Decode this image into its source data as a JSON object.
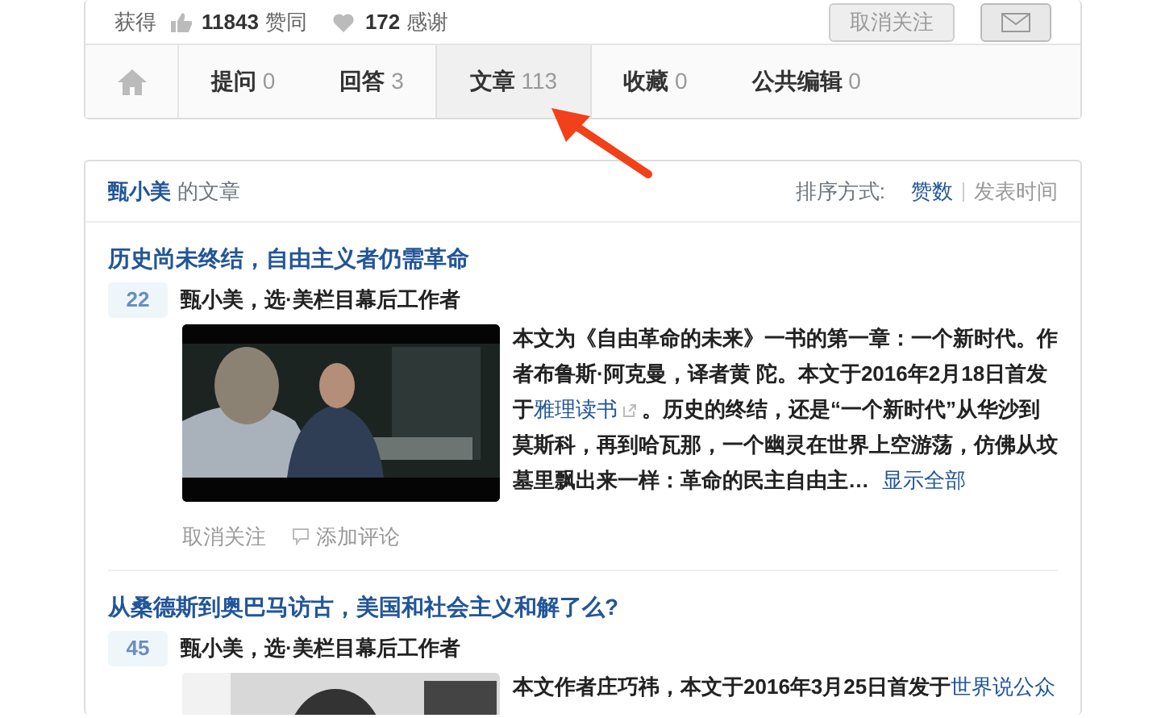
{
  "profile": {
    "prefix": "获得",
    "stats": [
      {
        "kind": "like",
        "count": "11843",
        "label": "赞同"
      },
      {
        "kind": "thanks",
        "count": "172",
        "label": "感谢"
      }
    ],
    "unfollow_button": "取消关注"
  },
  "tabs": [
    {
      "label": "提问",
      "count": "0",
      "selected": false
    },
    {
      "label": "回答",
      "count": "3",
      "selected": false
    },
    {
      "label": "文章",
      "count": "113",
      "selected": true
    },
    {
      "label": "收藏",
      "count": "0",
      "selected": false
    },
    {
      "label": "公共编辑",
      "count": "0",
      "selected": false
    }
  ],
  "articles_header": {
    "owner": "甄小美",
    "suffix": "的文章",
    "sort_label": "排序方式:",
    "sort_options": [
      {
        "label": "赞数",
        "selected": true
      },
      {
        "label": "发表时间",
        "selected": false
      }
    ]
  },
  "articles": [
    {
      "title": "历史尚未终结，自由主义者仍需革命",
      "votes": "22",
      "author": "甄小美，选·美栏目幕后工作者",
      "picture": {
        "kind": "picture"
      },
      "excerpt": [
        {
          "kind": "text",
          "text": "本文为《自由革命的未来》一书的第一章：一个新时代。作者布鲁斯·阿克曼，译者黄 陀。本文于2016年2月18日首发于"
        },
        {
          "kind": "link",
          "text": "雅理读书",
          "external_icon": true
        },
        {
          "kind": "text",
          "text": "。历史的终结，还是“一个新时代”从华沙到莫斯科，再到哈瓦那，一个幽灵在世界上空游荡，仿佛从坟墓里飘出来一样：革命的民主自由主…"
        }
      ],
      "more": "显示全部",
      "actions": [
        {
          "kind": "unfollow",
          "label": "取消关注"
        },
        {
          "kind": "comment",
          "label": "添加评论"
        }
      ]
    },
    {
      "title": "从桑德斯到奥巴马访古，美国和社会主义和解了么?",
      "votes": "45",
      "author": "甄小美，选·美栏目幕后工作者",
      "picture": {
        "kind": "picture"
      },
      "excerpt": [
        {
          "kind": "text",
          "text": "本文作者庄巧祎，本文于2016年3月25日首发于"
        },
        {
          "kind": "link",
          "text": "世界说公众"
        }
      ]
    }
  ]
}
